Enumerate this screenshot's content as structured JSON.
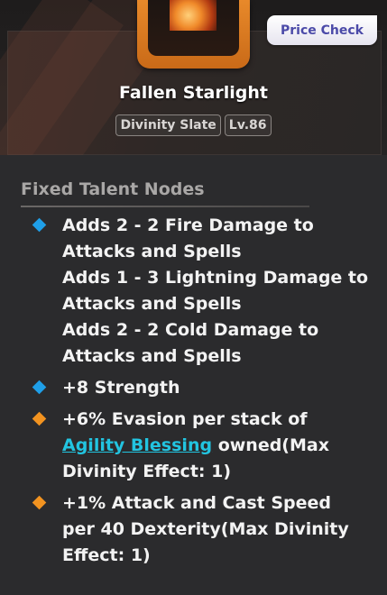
{
  "header": {
    "price_check_label": "Price Check",
    "item_name": "Fallen Starlight",
    "tag_type": "Divinity Slate",
    "tag_level": "Lv.86"
  },
  "section": {
    "title": "Fixed Talent Nodes"
  },
  "nodes": [
    {
      "color": "#1f9fe8",
      "lines": [
        "Adds 2 - 2 Fire Damage to",
        "Attacks and Spells",
        "Adds 1 - 3 Lightning Damage to",
        "Attacks and Spells",
        "Adds 2 - 2 Cold Damage to",
        "Attacks and Spells"
      ]
    },
    {
      "color": "#1f9fe8",
      "lines": [
        "+8 Strength"
      ]
    },
    {
      "color": "#f29320",
      "line1": "+6% Evasion per stack of",
      "link": "Agility Blessing",
      "line2_rest": " owned(Max",
      "line3": "Divinity Effect: 1)"
    },
    {
      "color": "#f29320",
      "lines": [
        "+1% Attack and Cast Speed",
        "per 40 Dexterity(Max Divinity",
        "Effect: 1)"
      ]
    }
  ],
  "icons": {
    "blue_node": "diamond-blue-icon",
    "orange_node": "diamond-orange-icon"
  }
}
